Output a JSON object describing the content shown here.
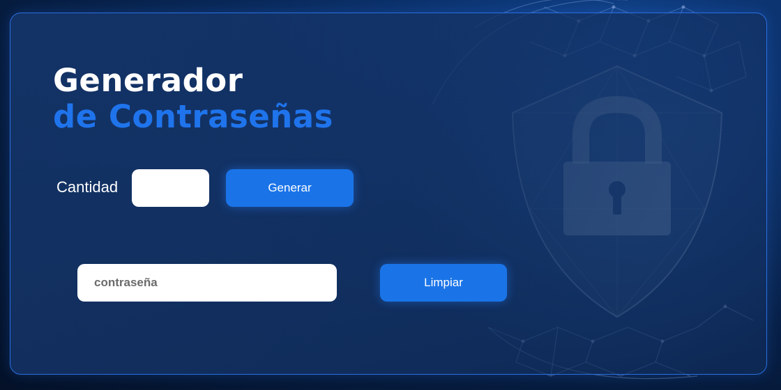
{
  "header": {
    "title_line1": "Generador",
    "title_line2": "de Contraseñas"
  },
  "form": {
    "quantity_label": "Cantidad",
    "quantity_value": "",
    "generate_label": "Generar",
    "password_placeholder": "contraseña",
    "password_value": "",
    "clear_label": "Limpiar"
  },
  "colors": {
    "accent": "#1a74e8",
    "title_accent": "#1f74ec",
    "background": "#0a2a5c",
    "border": "#2a6fe0"
  },
  "decoration": {
    "background_icon": "shield-lock-icon",
    "globe": "network-globe"
  }
}
